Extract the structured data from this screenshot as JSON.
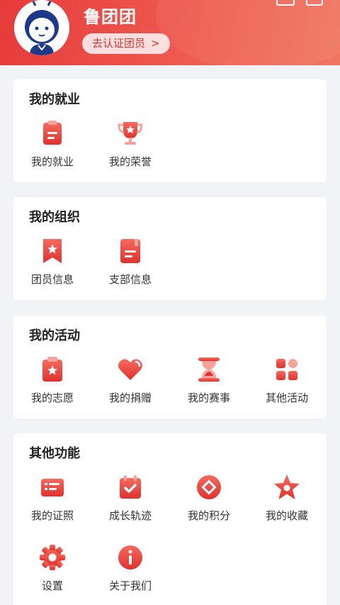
{
  "header": {
    "username": "鲁团团",
    "verify_label": "去认证团员",
    "verify_arrow": ">"
  },
  "sections": {
    "employment": {
      "title": "我的就业",
      "items": [
        {
          "label": "我的就业",
          "icon": "clipboard-icon"
        },
        {
          "label": "我的荣誉",
          "icon": "trophy-icon"
        }
      ]
    },
    "organization": {
      "title": "我的组织",
      "items": [
        {
          "label": "团员信息",
          "icon": "bookmark-icon"
        },
        {
          "label": "支部信息",
          "icon": "book-icon"
        }
      ]
    },
    "activities": {
      "title": "我的活动",
      "items": [
        {
          "label": "我的志愿",
          "icon": "volunteer-icon"
        },
        {
          "label": "我的捐赠",
          "icon": "heart-icon"
        },
        {
          "label": "我的赛事",
          "icon": "hourglass-icon"
        },
        {
          "label": "其他活动",
          "icon": "grid-icon"
        }
      ]
    },
    "other": {
      "title": "其他功能",
      "items": [
        {
          "label": "我的证照",
          "icon": "id-card-icon"
        },
        {
          "label": "成长轨迹",
          "icon": "calendar-check-icon"
        },
        {
          "label": "我的积分",
          "icon": "points-icon"
        },
        {
          "label": "我的收藏",
          "icon": "star-icon"
        },
        {
          "label": "设置",
          "icon": "gear-icon"
        },
        {
          "label": "关于我们",
          "icon": "info-icon"
        }
      ]
    }
  },
  "colors": {
    "brand_red": "#e63b3b",
    "icon_red": "#ec4a43",
    "background": "#f2f3f6"
  }
}
